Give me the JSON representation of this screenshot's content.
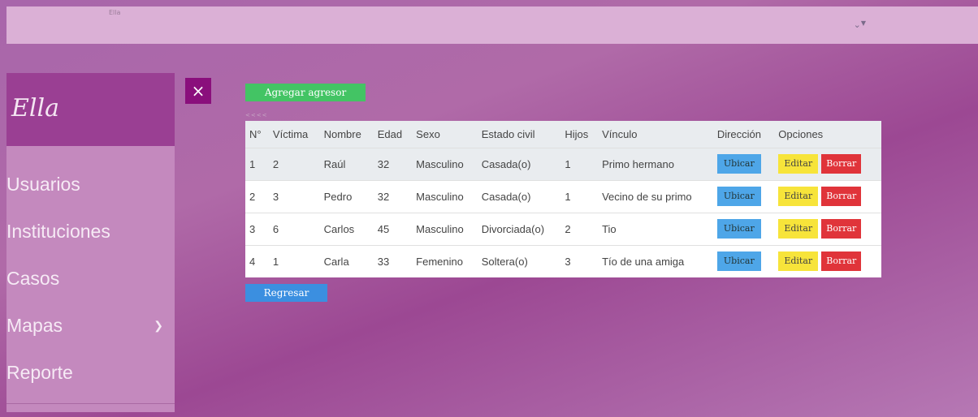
{
  "topbar": {
    "brand_small": "Ella",
    "user_menu_icon": "chevron-down-icon"
  },
  "sidebar": {
    "logo": "Ella",
    "items": [
      {
        "label": "Usuarios"
      },
      {
        "label": "Instituciones"
      },
      {
        "label": "Casos"
      },
      {
        "label": "Mapas",
        "has_submenu": true
      },
      {
        "label": "Reporte"
      }
    ]
  },
  "close_button": {
    "label": "×"
  },
  "add_button": {
    "label": "Agregar agresor"
  },
  "pager": {
    "label": "<<<<"
  },
  "table": {
    "columns": [
      "N°",
      "Víctima",
      "Nombre",
      "Edad",
      "Sexo",
      "Estado civil",
      "Hijos",
      "Vínculo",
      "Dirección",
      "Opciones"
    ],
    "rows": [
      {
        "n": "1",
        "victima": "2",
        "nombre": "Raúl",
        "edad": "32",
        "sexo": "Masculino",
        "estado": "Casada(o)",
        "hijos": "1",
        "vinculo": "Primo hermano"
      },
      {
        "n": "2",
        "victima": "3",
        "nombre": "Pedro",
        "edad": "32",
        "sexo": "Masculino",
        "estado": "Casada(o)",
        "hijos": "1",
        "vinculo": "Vecino de su primo"
      },
      {
        "n": "3",
        "victima": "6",
        "nombre": "Carlos",
        "edad": "45",
        "sexo": "Masculino",
        "estado": "Divorciada(o)",
        "hijos": "2",
        "vinculo": "Tio"
      },
      {
        "n": "4",
        "victima": "1",
        "nombre": "Carla",
        "edad": "33",
        "sexo": "Femenino",
        "estado": "Soltera(o)",
        "hijos": "3",
        "vinculo": "Tío de una amiga"
      }
    ],
    "actions": {
      "ubicar": "Ubicar",
      "editar": "Editar",
      "borrar": "Borrar"
    }
  },
  "back_button": {
    "label": "Regresar"
  },
  "colors": {
    "accent_green": "#43c464",
    "accent_blue": "#3b8fe0",
    "delete_red": "#e0343a",
    "edit_yellow": "#f7e43a",
    "sidebar_dark": "#9a3f93"
  }
}
